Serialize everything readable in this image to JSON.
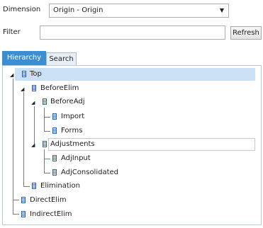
{
  "dimension": {
    "label": "Dimension",
    "value": "Origin - Origin",
    "caret": "▼"
  },
  "filter": {
    "label": "Filter",
    "value": "",
    "placeholder": ""
  },
  "refresh_label": "Refresh",
  "tabs": [
    {
      "label": "Hierarchy"
    },
    {
      "label": "Search"
    }
  ],
  "tree": {
    "nodes": [
      {
        "label": "Top",
        "expanded": true,
        "selected": true
      },
      {
        "label": "BeforeElim",
        "expanded": true
      },
      {
        "label": "BeforeAdj",
        "expanded": true
      },
      {
        "label": "Import"
      },
      {
        "label": "Forms"
      },
      {
        "label": "Adjustments",
        "expanded": true,
        "focused": true
      },
      {
        "label": "AdjInput"
      },
      {
        "label": "AdjConsolidated"
      },
      {
        "label": "Elimination"
      },
      {
        "label": "DirectElim"
      },
      {
        "label": "IndirectElim"
      }
    ],
    "expander_glyph": "◢"
  },
  "colors": {
    "accent": "#3c8ed3",
    "selection": "#cce0f5",
    "node_icon": "#2f63b0"
  }
}
